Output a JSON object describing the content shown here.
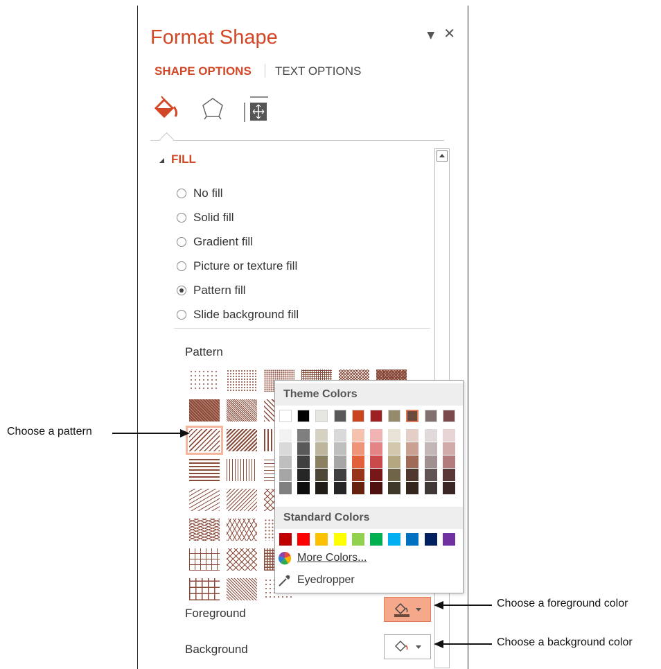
{
  "pane": {
    "title": "Format Shape",
    "tabs": {
      "shape_options": "SHAPE OPTIONS",
      "text_options": "TEXT OPTIONS"
    },
    "icons": [
      "paint-bucket-icon",
      "pentagon-icon",
      "size-properties-icon"
    ]
  },
  "fill": {
    "header": "FILL",
    "options": [
      {
        "label": "No fill",
        "selected": false
      },
      {
        "label": "Solid fill",
        "selected": false
      },
      {
        "label": "Gradient fill",
        "selected": false
      },
      {
        "label": "Picture or texture fill",
        "selected": false
      },
      {
        "label": "Pattern fill",
        "selected": true
      },
      {
        "label": "Slide background fill",
        "selected": false
      }
    ],
    "pattern_label": "Pattern",
    "foreground_label": "Foreground",
    "background_label": "Background"
  },
  "palette": {
    "theme_header": "Theme Colors",
    "standard_header": "Standard Colors",
    "more_colors": "More Colors...",
    "eyedropper": "Eyedropper",
    "theme_top": [
      "#ffffff",
      "#000000",
      "#e7e6e0",
      "#595959",
      "#c9451f",
      "#9e2121",
      "#958a6b",
      "#6b4a3e",
      "#807070",
      "#7a4a4a"
    ],
    "theme_selected_index": 7,
    "theme_shades": [
      [
        "#f2f2f2",
        "#d9d9d9",
        "#bfbfbf",
        "#a6a6a6",
        "#808080"
      ],
      [
        "#7f7f7f",
        "#595959",
        "#404040",
        "#262626",
        "#0d0d0d"
      ],
      [
        "#d6d2c3",
        "#bdb59c",
        "#8c8062",
        "#4e4736",
        "#1f1d16"
      ],
      [
        "#d9d9d9",
        "#bfbfbf",
        "#a6a6a6",
        "#404040",
        "#262626"
      ],
      [
        "#f5c2b0",
        "#ee9479",
        "#e2603c",
        "#973419",
        "#64220f"
      ],
      [
        "#f1b3b3",
        "#e48585",
        "#c94a4a",
        "#771818",
        "#4f1010"
      ],
      [
        "#e8e3d6",
        "#d1c8ae",
        "#b5a77f",
        "#6f6447",
        "#3f3929"
      ],
      [
        "#e4cfc8",
        "#c9a091",
        "#a06a56",
        "#4f372e",
        "#35251f"
      ],
      [
        "#e0dada",
        "#c2b6b6",
        "#a09090",
        "#5f5353",
        "#403737"
      ],
      [
        "#e8d4d4",
        "#d1aaaa",
        "#b27c7c",
        "#5a3737",
        "#3c2525"
      ]
    ],
    "standard": [
      "#c00000",
      "#ff0000",
      "#ffc000",
      "#ffff00",
      "#92d050",
      "#00b050",
      "#00b0f0",
      "#0070c0",
      "#002060",
      "#7030a0"
    ]
  },
  "callouts": {
    "pattern": "Choose a pattern",
    "foreground": "Choose a foreground color",
    "background": "Choose a background color"
  }
}
